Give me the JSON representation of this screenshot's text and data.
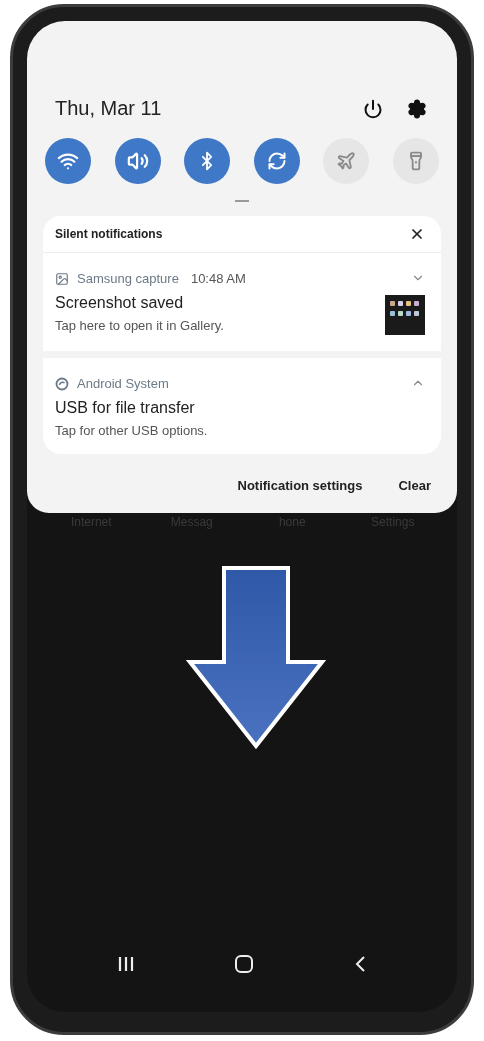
{
  "quick_panel": {
    "date": "Thu, Mar 11",
    "toggles": [
      {
        "kind": "wifi",
        "on": true
      },
      {
        "kind": "sound",
        "on": true
      },
      {
        "kind": "bluetooth",
        "on": true
      },
      {
        "kind": "rotate",
        "on": true
      },
      {
        "kind": "airplane",
        "on": false
      },
      {
        "kind": "flashlight",
        "on": false
      }
    ]
  },
  "notifications": {
    "header": "Silent notifications",
    "items": [
      {
        "kind": "capture",
        "app": "Samsung capture",
        "time": "10:48 AM",
        "title": "Screenshot saved",
        "text": "Tap here to open it in Gallery.",
        "expanded": false
      },
      {
        "kind": "system",
        "app": "Android System",
        "title": "USB for file transfer",
        "text": "Tap for other USB options.",
        "expanded": true
      }
    ],
    "buttons": [
      "Notification settings",
      "Clear"
    ]
  },
  "home_labels": [
    "Internet",
    "Messag",
    "hone",
    "Settings"
  ]
}
